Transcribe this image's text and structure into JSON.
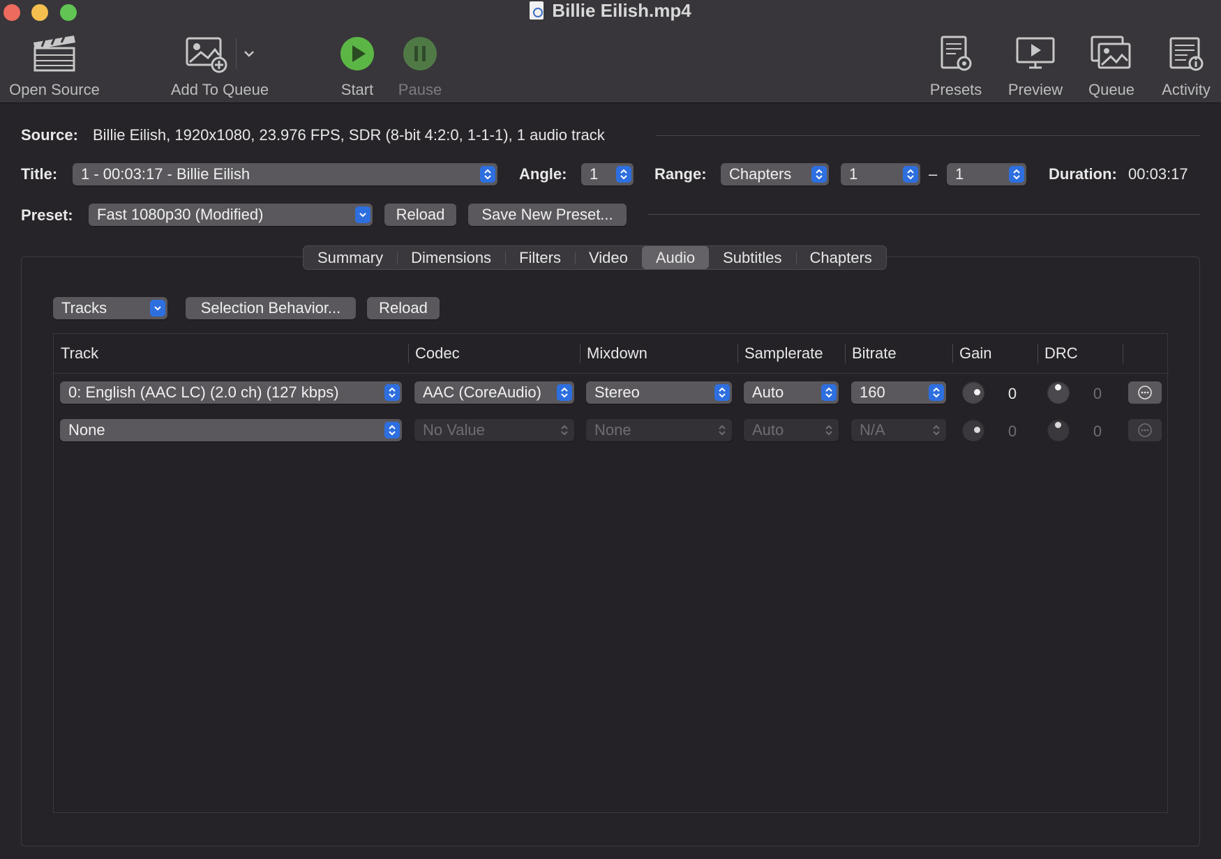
{
  "window": {
    "title": "Billie Eilish.mp4"
  },
  "toolbar": {
    "open_source": "Open Source",
    "add_to_queue": "Add To Queue",
    "start": "Start",
    "pause": "Pause",
    "presets": "Presets",
    "preview": "Preview",
    "queue": "Queue",
    "activity": "Activity"
  },
  "source": {
    "label": "Source:",
    "value": "Billie Eilish, 1920x1080, 23.976 FPS, SDR (8-bit 4:2:0, 1-1-1), 1 audio track"
  },
  "title_row": {
    "title_label": "Title:",
    "title_value": "1 - 00:03:17 - Billie Eilish",
    "angle_label": "Angle:",
    "angle_value": "1",
    "range_label": "Range:",
    "range_mode": "Chapters",
    "range_start": "1",
    "range_dash": "–",
    "range_end": "1",
    "duration_label": "Duration:",
    "duration_value": "00:03:17"
  },
  "preset_row": {
    "label": "Preset:",
    "value": "Fast 1080p30 (Modified)",
    "reload": "Reload",
    "save_new": "Save New Preset..."
  },
  "tabs": [
    "Summary",
    "Dimensions",
    "Filters",
    "Video",
    "Audio",
    "Subtitles",
    "Chapters"
  ],
  "active_tab": "Audio",
  "audio": {
    "tracks_popup": "Tracks",
    "selection_behavior": "Selection Behavior...",
    "reload": "Reload",
    "columns": [
      "Track",
      "Codec",
      "Mixdown",
      "Samplerate",
      "Bitrate",
      "Gain",
      "DRC"
    ],
    "rows": [
      {
        "track": "0: English (AAC LC) (2.0 ch) (127 kbps)",
        "codec": "AAC (CoreAudio)",
        "mixdown": "Stereo",
        "samplerate": "Auto",
        "bitrate": "160",
        "gain": "0",
        "drc": "0",
        "enabled": true
      },
      {
        "track": "None",
        "codec": "No Value",
        "mixdown": "None",
        "samplerate": "Auto",
        "bitrate": "N/A",
        "gain": "0",
        "drc": "0",
        "enabled": false
      }
    ]
  },
  "colors": {
    "accent": "#2e6fe0",
    "start_green": "#5cb646",
    "pause_green": "#4f7a46",
    "background": "#262428",
    "toolbar": "#38363a"
  }
}
